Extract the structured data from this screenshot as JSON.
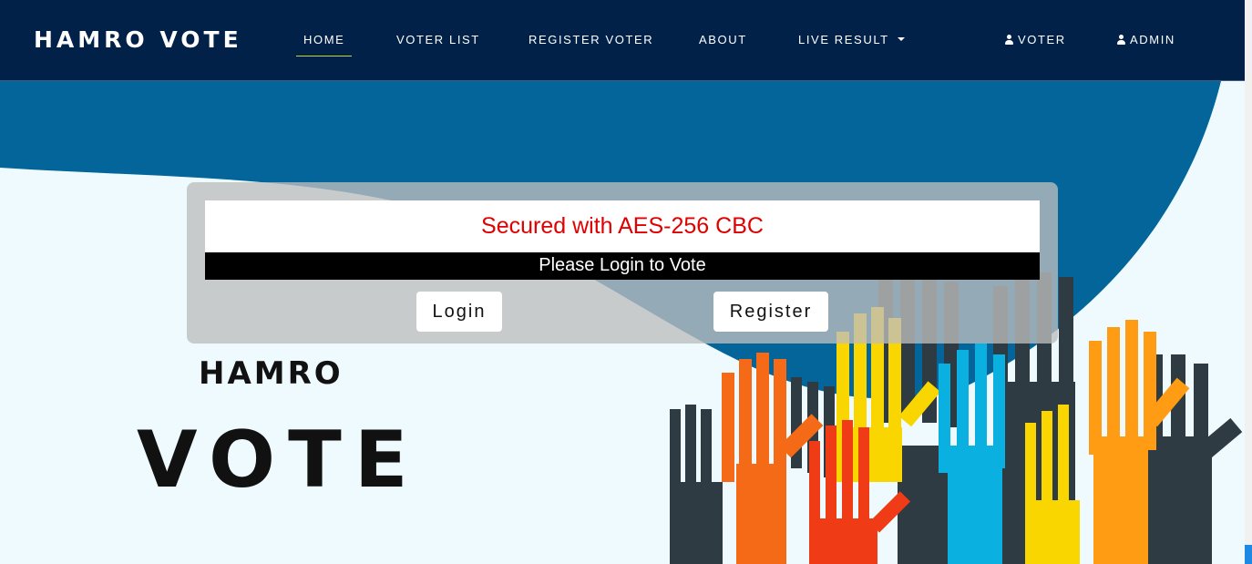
{
  "navbar": {
    "brand": "HAMRO VOTE",
    "items": [
      {
        "label": "HOME",
        "active": true
      },
      {
        "label": "VOTER LIST"
      },
      {
        "label": "REGISTER VOTER"
      },
      {
        "label": "ABOUT"
      },
      {
        "label": "LIVE RESULT",
        "dropdown": true
      }
    ],
    "right": [
      {
        "label": "VOTER",
        "icon": "user-icon"
      },
      {
        "label": "ADMIN",
        "icon": "user-icon"
      }
    ]
  },
  "card": {
    "security_text": "Secured with AES-256 CBC",
    "prompt": "Please Login to Vote",
    "login_label": "Login",
    "register_label": "Register"
  },
  "logo": {
    "line1": "HAMRO",
    "line2": "VOTE"
  },
  "colors": {
    "navbar_bg": "#022148",
    "wave_blue": "#036599",
    "security_text": "#e00000",
    "active_underline": "#c8d640"
  }
}
